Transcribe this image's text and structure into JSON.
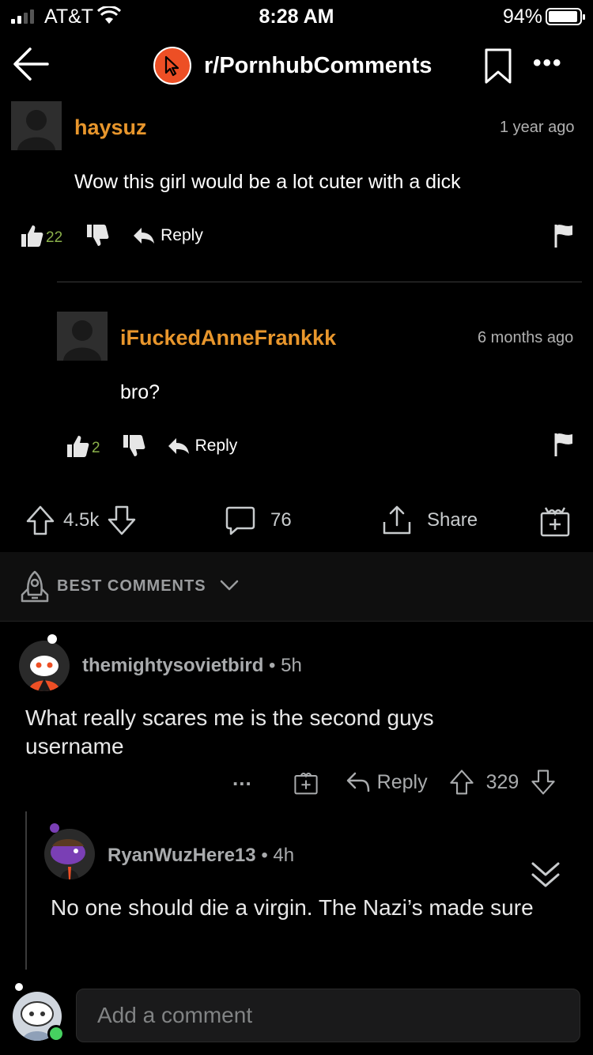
{
  "status_bar": {
    "carrier": "AT&T",
    "time": "8:28 AM",
    "battery": "94%",
    "battery_level": 0.94
  },
  "header": {
    "subreddit": "r/PornhubComments",
    "icons": [
      "back-arrow-icon",
      "subreddit-icon",
      "bookmark-icon",
      "more-icon"
    ]
  },
  "screenshot_comments": [
    {
      "user": "haysuz",
      "time": "1 year ago",
      "text": "Wow this girl would be a lot cuter with a dick",
      "likes": "22",
      "reply_label": "Reply"
    },
    {
      "user": "iFuckedAnneFrankkk",
      "time": "6 months ago",
      "text": "bro?",
      "likes": "2",
      "reply_label": "Reply"
    }
  ],
  "post_actions": {
    "score": "4.5k",
    "comments": "76",
    "share": "Share"
  },
  "sort": {
    "label": "BEST COMMENTS"
  },
  "comments": [
    {
      "user": "themightysovietbird",
      "age": "5h",
      "text": "What really scares me is the second guys username",
      "more": "...",
      "reply_label": "Reply",
      "score": "329"
    },
    {
      "user": "RyanWuzHere13",
      "age": "4h",
      "text": "No one should die a virgin. The Nazi’s made sure"
    }
  ],
  "composer": {
    "placeholder": "Add a comment"
  },
  "colors": {
    "background": "#000000",
    "username_orange": "#e8962c",
    "reddit_orange": "#ed4f25",
    "online_green": "#46d160"
  }
}
